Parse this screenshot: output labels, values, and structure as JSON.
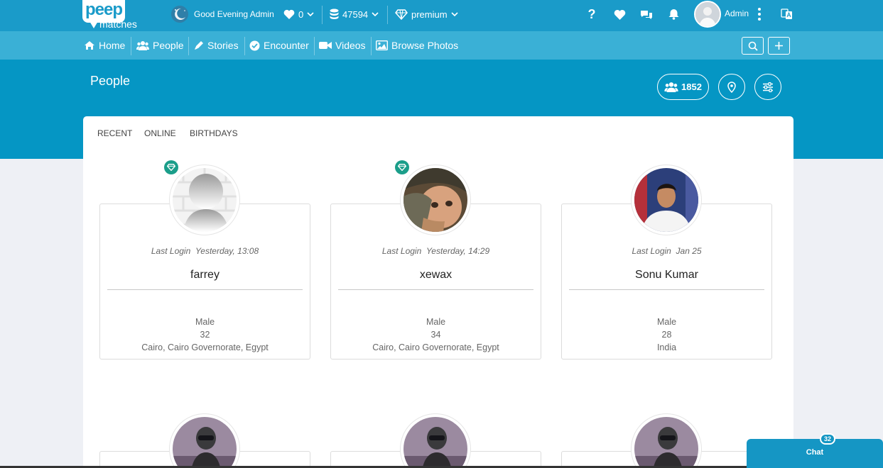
{
  "brand": {
    "logo_main": "peep",
    "logo_sub": "matches"
  },
  "topbar": {
    "greeting": "Good Evening Admin",
    "likes_count": "0",
    "credits": "47594",
    "plan": "premium",
    "user_name": "Admin"
  },
  "nav": {
    "items": [
      {
        "label": "Home",
        "icon": "home-icon"
      },
      {
        "label": "People",
        "icon": "people-icon"
      },
      {
        "label": "Stories",
        "icon": "pencil-icon"
      },
      {
        "label": "Encounter",
        "icon": "check-circle-icon"
      },
      {
        "label": "Videos",
        "icon": "video-camera-icon"
      },
      {
        "label": "Browse Photos",
        "icon": "image-icon"
      }
    ]
  },
  "header": {
    "title": "People",
    "people_count": "1852"
  },
  "tabs": [
    "RECENT",
    "ONLINE",
    "BIRTHDAYS"
  ],
  "people": [
    {
      "name": "farrey",
      "last_login_label": "Last Login",
      "last_login": "Yesterday, 13:08",
      "gender": "Male",
      "age": "32",
      "location": "Cairo, Cairo Governorate, Egypt",
      "premium": true
    },
    {
      "name": "xewax",
      "last_login_label": "Last Login",
      "last_login": "Yesterday, 14:29",
      "gender": "Male",
      "age": "34",
      "location": "Cairo, Cairo Governorate, Egypt",
      "premium": true
    },
    {
      "name": "Sonu Kumar",
      "last_login_label": "Last Login",
      "last_login": "Jan 25",
      "gender": "Male",
      "age": "28",
      "location": "India",
      "premium": false
    }
  ],
  "chat": {
    "label": "Chat",
    "count": "32"
  },
  "colors": {
    "topbar": "#1a9bc9",
    "navbar": "#3ab0d6",
    "band": "#0596c4",
    "premium_gem": "#1b9e8a"
  }
}
